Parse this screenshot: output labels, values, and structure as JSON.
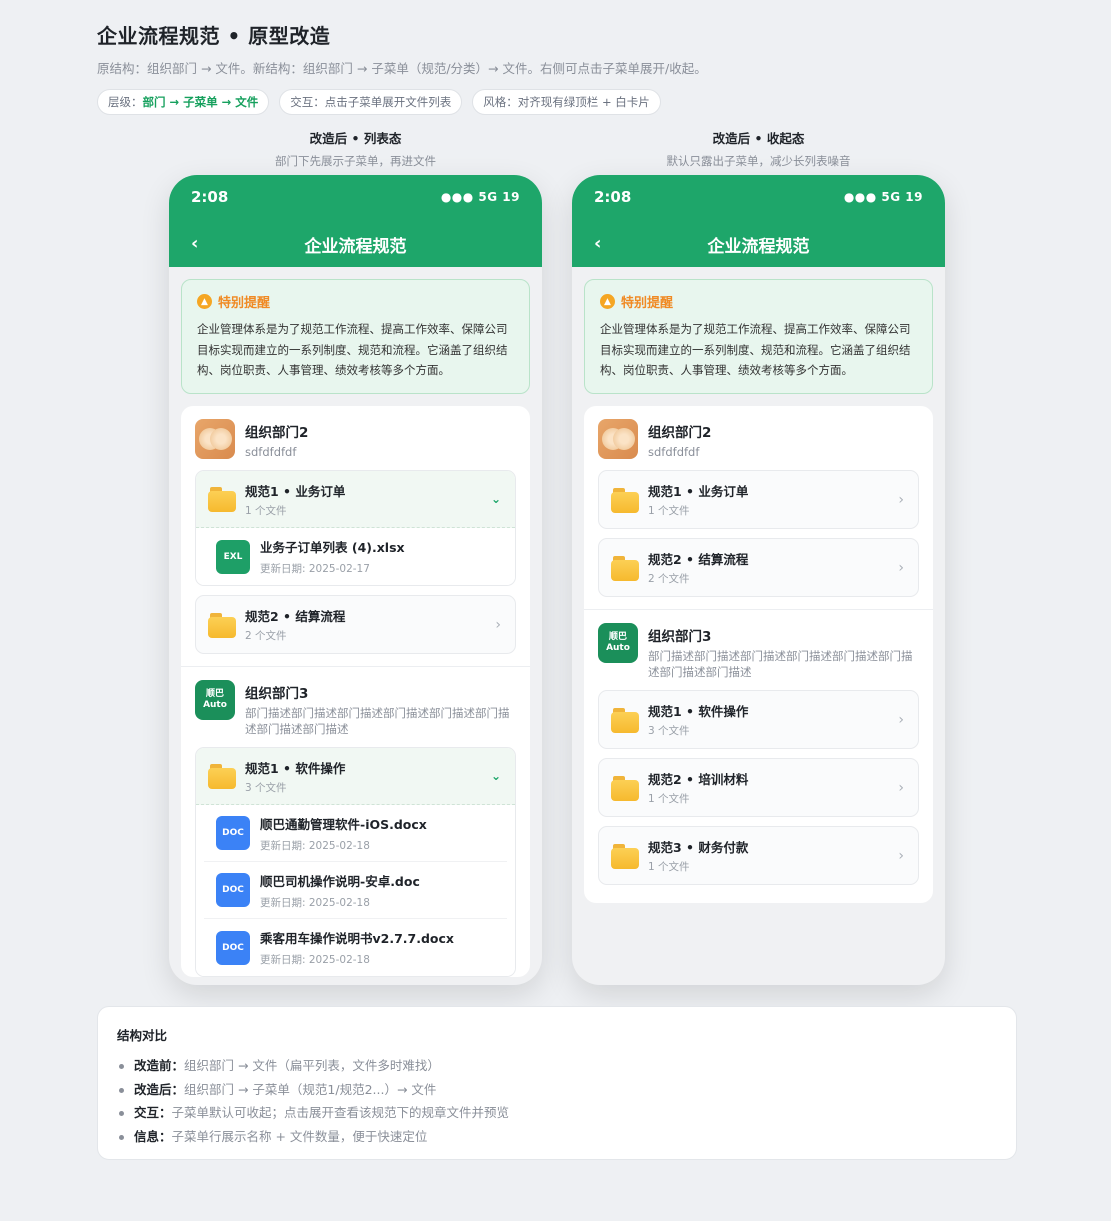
{
  "header": {
    "title": "企业流程规范 • 原型改造",
    "subtitle": "原结构：组织部门 → 文件。新结构：组织部门 → 子菜单（规范/分类）→ 文件。右侧可点击子菜单展开/收起。",
    "chips": {
      "hierarchy_prefix": "层级：",
      "hierarchy_value": "部门 → 子菜单 → 文件",
      "interaction": "交互：点击子菜单展开文件列表",
      "style": "风格：对齐现有绿顶栏 + 白卡片"
    }
  },
  "columns": {
    "left": {
      "title": "改造后 • 列表态",
      "subtitle": "部门下先展示子菜单，再进文件"
    },
    "right": {
      "title": "改造后 • 收起态",
      "subtitle": "默认只露出子菜单，减少长列表噪音"
    }
  },
  "phone": {
    "time": "2:08",
    "status": "●●● 5G 19",
    "back_icon": "‹",
    "title": "企业流程规范",
    "notice_title": "特别提醒",
    "notice_body": "企业管理体系是为了规范工作流程、提高工作效率、保障公司目标实现而建立的一系列制度、规范和流程。它涵盖了组织结构、岗位职责、人事管理、绩效考核等多个方面。"
  },
  "dept2": {
    "name": "组织部门2",
    "desc": "sdfdfdfdf",
    "sub1": {
      "name": "规范1 • 业务订单",
      "count": "1 个文件"
    },
    "sub1_file": {
      "badge": "EXL",
      "name": "业务子订单列表 (4).xlsx",
      "date": "更新日期: 2025-02-17"
    },
    "sub2": {
      "name": "规范2 • 结算流程",
      "count": "2 个文件"
    }
  },
  "dept3": {
    "name": "组织部门3",
    "avatar_line1": "顺巴",
    "avatar_line2": "Auto",
    "desc": "部门描述部门描述部门描述部门描述部门描述部门描述部门描述部门描述",
    "sub1": {
      "name": "规范1 • 软件操作",
      "count": "3 个文件"
    },
    "sub1_files": [
      {
        "badge": "DOC",
        "name": "顺巴通勤管理软件-iOS.docx",
        "date": "更新日期: 2025-02-18"
      },
      {
        "badge": "DOC",
        "name": "顺巴司机操作说明-安卓.doc",
        "date": "更新日期: 2025-02-18"
      },
      {
        "badge": "DOC",
        "name": "乘客用车操作说明书v2.7.7.docx",
        "date": "更新日期: 2025-02-18"
      }
    ],
    "sub2": {
      "name": "规范2 • 培训材料",
      "count": "1 个文件"
    },
    "sub3": {
      "name": "规范3 • 财务付款",
      "count": "1 个文件"
    }
  },
  "summary": {
    "title": "结构对比",
    "items": [
      {
        "label": "改造前：",
        "text": "组织部门 → 文件（扁平列表，文件多时难找）"
      },
      {
        "label": "改造后：",
        "text": "组织部门 → 子菜单（规范1/规范2...）→ 文件"
      },
      {
        "label": "交互：",
        "text": "子菜单默认可收起；点击展开查看该规范下的规章文件并预览"
      },
      {
        "label": "信息：",
        "text": "子菜单行展示名称 + 文件数量，便于快速定位"
      }
    ]
  },
  "colors": {
    "brand_green": "#1ea66a",
    "notice_orange": "#f08a24",
    "doc_blue": "#3b82f6",
    "excel_green": "#1e9f67"
  }
}
